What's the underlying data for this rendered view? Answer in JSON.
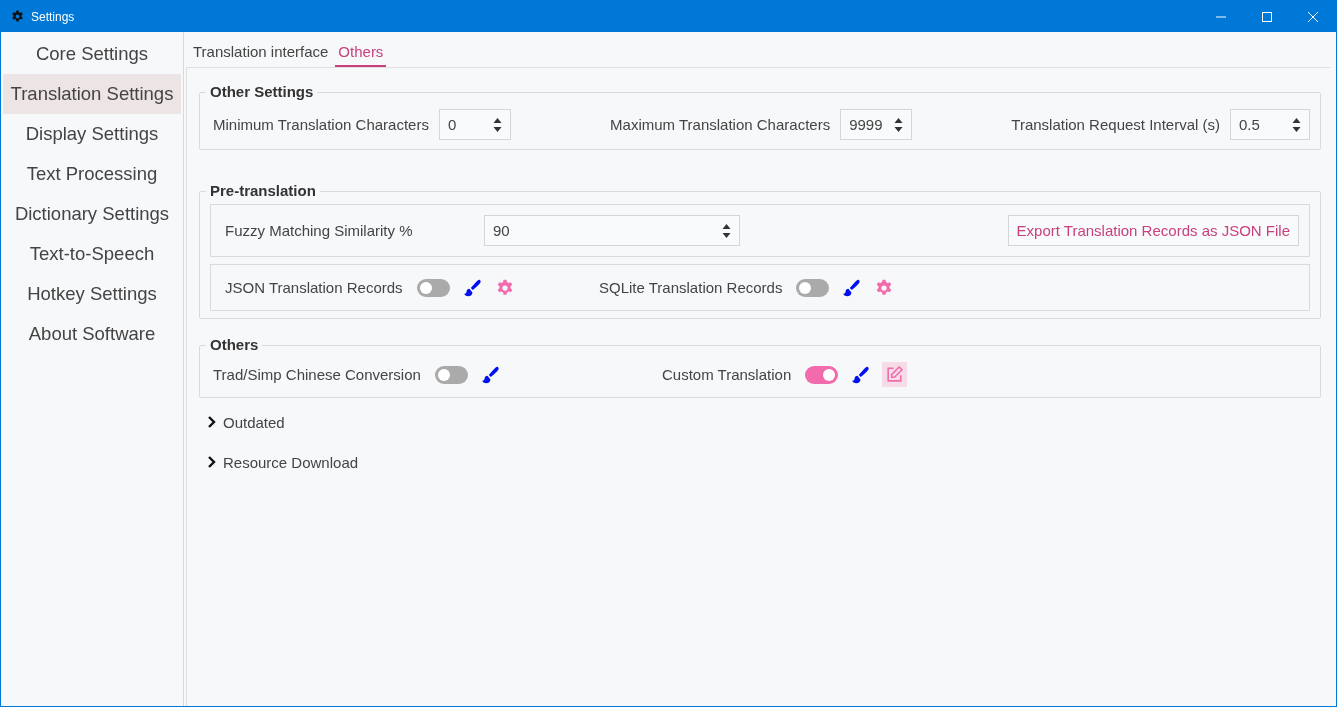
{
  "window": {
    "title": "Settings"
  },
  "sidebar": {
    "items": [
      {
        "label": "Core Settings",
        "selected": false
      },
      {
        "label": "Translation Settings",
        "selected": true
      },
      {
        "label": "Display Settings",
        "selected": false
      },
      {
        "label": "Text Processing",
        "selected": false
      },
      {
        "label": "Dictionary Settings",
        "selected": false
      },
      {
        "label": "Text-to-Speech",
        "selected": false
      },
      {
        "label": "Hotkey Settings",
        "selected": false
      },
      {
        "label": "About Software",
        "selected": false
      }
    ]
  },
  "tabs": [
    {
      "label": "Translation interface",
      "selected": false
    },
    {
      "label": "Others",
      "selected": true
    }
  ],
  "other_settings": {
    "title": "Other Settings",
    "fields": [
      {
        "label": "Minimum Translation Characters",
        "value": "0"
      },
      {
        "label": "Maximum Translation Characters",
        "value": "9999"
      },
      {
        "label": "Translation Request Interval (s)",
        "value": "0.5"
      }
    ]
  },
  "pre_translation": {
    "title": "Pre-translation",
    "fuzzy": {
      "label": "Fuzzy Matching Similarity %",
      "value": "90"
    },
    "export_button": "Export Translation Records as JSON File",
    "toggles": [
      {
        "label": "JSON Translation Records",
        "on": false,
        "kind": "gear"
      },
      {
        "label": "SQLite Translation Records",
        "on": false,
        "kind": "gear"
      }
    ]
  },
  "others": {
    "title": "Others",
    "toggles": [
      {
        "label": "Trad/Simp Chinese Conversion",
        "on": false,
        "kind": "plain"
      },
      {
        "label": "Custom Translation",
        "on": true,
        "kind": "edit"
      }
    ]
  },
  "collapsibles": [
    {
      "label": "Outdated",
      "expanded": false
    },
    {
      "label": "Resource Download",
      "expanded": false
    }
  ]
}
